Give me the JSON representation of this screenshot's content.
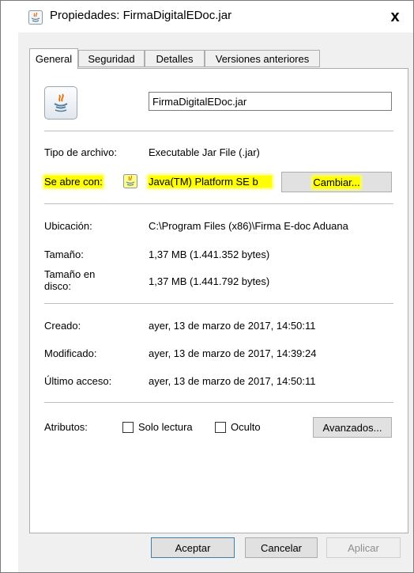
{
  "window": {
    "title": "Propiedades: FirmaDigitalEDoc.jar",
    "close_label": "x"
  },
  "tabs": [
    {
      "label": "General",
      "active": true
    },
    {
      "label": "Seguridad",
      "active": false
    },
    {
      "label": "Detalles",
      "active": false
    },
    {
      "label": "Versiones anteriores",
      "active": false
    }
  ],
  "general": {
    "file_name": "FirmaDigitalEDoc.jar",
    "type_label": "Tipo de archivo:",
    "type_value": "Executable Jar File (.jar)",
    "opens_with_label": "Se abre con:",
    "opens_with_value": "Java(TM) Platform SE b",
    "change_button": "Cambiar...",
    "location_label": "Ubicación:",
    "location_value": "C:\\Program Files (x86)\\Firma E-doc Aduana",
    "size_label": "Tamaño:",
    "size_value": "1,37 MB (1.441.352 bytes)",
    "size_on_disk_label_1": "Tamaño en",
    "size_on_disk_label_2": "disco:",
    "size_on_disk_value": "1,37 MB (1.441.792 bytes)",
    "created_label": "Creado:",
    "created_value": "ayer, 13 de marzo de 2017, 14:50:11",
    "modified_label": "Modificado:",
    "modified_value": "ayer, 13 de marzo de 2017, 14:39:24",
    "accessed_label": "Último acceso:",
    "accessed_value": "ayer, 13 de marzo de 2017, 14:50:11",
    "attributes_label": "Atributos:",
    "readonly_label": "Solo lectura",
    "hidden_label": "Oculto",
    "advanced_button": "Avanzados..."
  },
  "footer": {
    "ok": "Aceptar",
    "cancel": "Cancelar",
    "apply": "Aplicar"
  },
  "colors": {
    "highlight": "#ffff00",
    "panel": "#f0f0f0"
  }
}
